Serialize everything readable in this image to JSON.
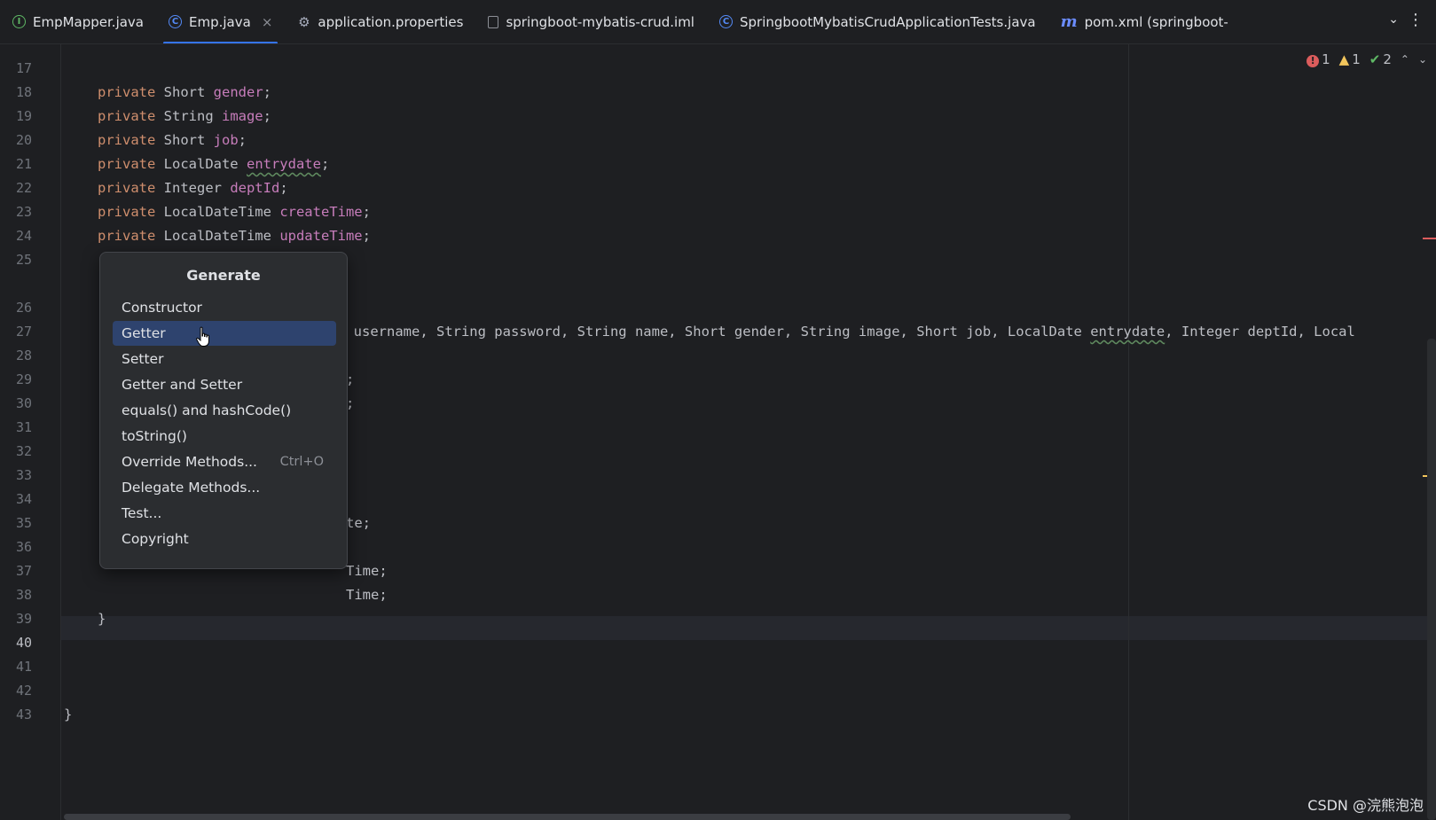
{
  "tabs": [
    {
      "label": "EmpMapper.java",
      "icon": "interface-icon",
      "active": false
    },
    {
      "label": "Emp.java",
      "icon": "class-icon",
      "active": true
    },
    {
      "label": "application.properties",
      "icon": "gear-icon",
      "active": false
    },
    {
      "label": "springboot-mybatis-crud.iml",
      "icon": "file-icon",
      "active": false
    },
    {
      "label": "SpringbootMybatisCrudApplicationTests.java",
      "icon": "class-icon",
      "active": false
    },
    {
      "label": "pom.xml (springboot-",
      "icon": "maven-icon",
      "active": false
    }
  ],
  "tab_icons": {
    "interface": "I",
    "class": "C",
    "maven": "m",
    "close": "×",
    "gear": "⚙"
  },
  "inspections": {
    "errors": "1",
    "warnings": "1",
    "ok": "2"
  },
  "code": {
    "l17": {
      "num": "17",
      "a": "private ",
      "b": "Short ",
      "c": "gender",
      "d": ";"
    },
    "l18": {
      "num": "18",
      "a": "private ",
      "b": "String ",
      "c": "image",
      "d": ";"
    },
    "l19": {
      "num": "19",
      "a": "private ",
      "b": "Short ",
      "c": "job",
      "d": ";"
    },
    "l20": {
      "num": "20",
      "a": "private ",
      "b": "LocalDate ",
      "c": "entrydate",
      "d": ";"
    },
    "l21": {
      "num": "21",
      "a": "private ",
      "b": "Integer ",
      "c": "deptId",
      "d": ";"
    },
    "l22": {
      "num": "22",
      "a": "private ",
      "b": "LocalDateTime ",
      "c": "createTime",
      "d": ";"
    },
    "l23": {
      "num": "23",
      "a": "private ",
      "b": "LocalDateTime ",
      "c": "updateTime",
      "d": ";"
    },
    "l24": {
      "num": "24"
    },
    "l25": {
      "num": "25"
    },
    "l26": {
      "num": "26",
      "a": "g username, String password, String name, Short gender, String image, Short job, LocalDate ",
      "c": "entrydate",
      "d": ", Integer deptId, Local"
    },
    "l27": {
      "num": "27"
    },
    "l28": {
      "num": "28",
      "a": ";"
    },
    "l29": {
      "num": "29",
      "a": ";"
    },
    "l30": {
      "num": "30"
    },
    "l31": {
      "num": "31"
    },
    "l32": {
      "num": "32"
    },
    "l33": {
      "num": "33"
    },
    "l34": {
      "num": "34",
      "a": "te;"
    },
    "l35": {
      "num": "35"
    },
    "l36": {
      "num": "36",
      "a": "Time;"
    },
    "l37": {
      "num": "37",
      "a": "Time;"
    },
    "l38": {
      "num": "38",
      "a": "}"
    },
    "l39": {
      "num": "39"
    },
    "l40": {
      "num": "40"
    },
    "l41": {
      "num": "41"
    },
    "l42": {
      "num": "42",
      "a": "}"
    },
    "l43": {
      "num": "43"
    }
  },
  "generate_menu": {
    "title": "Generate",
    "items": [
      {
        "label": "Constructor"
      },
      {
        "label": "Getter",
        "selected": true
      },
      {
        "label": "Setter"
      },
      {
        "label": "Getter and Setter"
      },
      {
        "label": "equals() and hashCode()"
      },
      {
        "label": "toString()"
      },
      {
        "label": "Override Methods...",
        "shortcut": "Ctrl+O"
      },
      {
        "label": "Delegate Methods..."
      },
      {
        "label": "Test..."
      },
      {
        "label": "Copyright"
      }
    ]
  },
  "watermark": "CSDN @浣熊泡泡"
}
